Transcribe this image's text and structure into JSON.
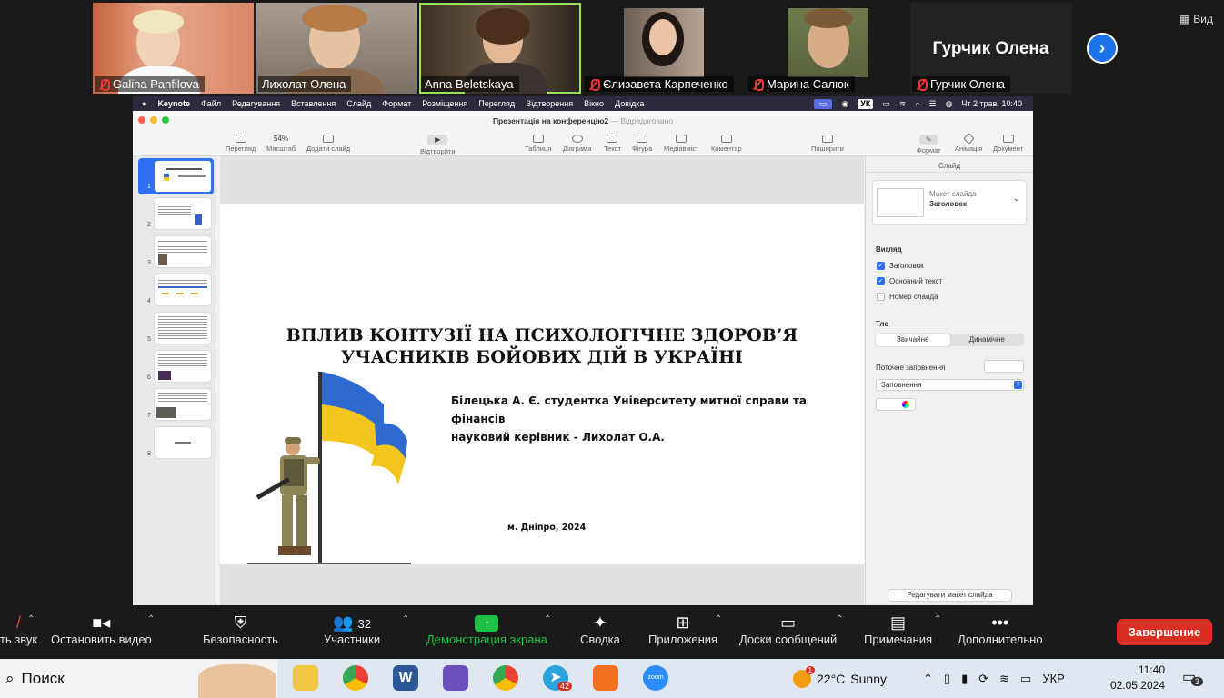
{
  "participants": [
    {
      "name": "Galina Panfilova",
      "muted": true,
      "video": true
    },
    {
      "name": "Лихолат Олена",
      "muted": false,
      "video": true
    },
    {
      "name": "Anna Beletskaya",
      "muted": false,
      "video": true,
      "active": true
    },
    {
      "name": "Єлизавета Карпеченко",
      "muted": true,
      "video": true
    },
    {
      "name": "Марина Салюк",
      "muted": true,
      "video": true
    },
    {
      "name": "Гурчик Олена",
      "muted": true,
      "video": false,
      "big_name": "Гурчик Олена"
    }
  ],
  "view_button": "Вид",
  "mac_menu": {
    "app": "Keynote",
    "items": [
      "Файл",
      "Редагування",
      "Вставлення",
      "Слайд",
      "Формат",
      "Розміщення",
      "Перегляд",
      "Відтворення",
      "Вікно",
      "Довідка"
    ],
    "input_lang": "УК",
    "clock": "Чт 2 трав. 10:40"
  },
  "keynote": {
    "doc_title": "Презентація на конференцію2",
    "doc_status": "— Відредаговано",
    "toolbar": {
      "view": "Перегляд",
      "zoom_value": "54%",
      "zoom": "Масштаб",
      "add_slide": "Додати слайд",
      "play": "Відтворити",
      "table": "Таблиця",
      "chart": "Діаграма",
      "text": "Текст",
      "shape": "Фігура",
      "media": "Медіавміст",
      "comment": "Коментар",
      "share": "Поширити",
      "format": "Формат",
      "animate": "Анімація",
      "document": "Документ"
    },
    "slide_numbers": [
      "1",
      "2",
      "3",
      "4",
      "5",
      "6",
      "7",
      "8"
    ],
    "slide": {
      "title_line1": "ВПЛИВ КОНТУЗІЇ НА ПСИХОЛОГІЧНЕ ЗДОРОВ’Я",
      "title_line2": "УЧАСНИКІВ БОЙОВИХ ДІЙ В УКРАЇНІ",
      "author_line1": "Білецька А. Є. студентка Університету митної справи та фінансів",
      "author_line2": "науковий керівник - Лихолат О.А.",
      "city": "м. Дніпро, 2024"
    },
    "inspector": {
      "tab": "Слайд",
      "layout_label": "Макет слайда",
      "layout_value": "Заголовок",
      "appearance": "Вигляд",
      "check_title": "Заголовок",
      "check_body": "Основний текст",
      "check_number": "Номер слайда",
      "background": "Тло",
      "seg_normal": "Звичайне",
      "seg_dynamic": "Динамічне",
      "current_fill": "Поточне заповнення",
      "fill_select": "Заповнення",
      "edit_layout": "Редагувати макет слайда"
    }
  },
  "zoom_controls": {
    "audio": "ть звук",
    "video": "Остановить видео",
    "security": "Безопасность",
    "participants": "Участники",
    "participants_count": "32",
    "share": "Демонстрация экрана",
    "summary": "Сводка",
    "apps": "Приложения",
    "whiteboards": "Доски сообщений",
    "notes": "Примечания",
    "more": "Дополнительно",
    "end": "Завершение"
  },
  "taskbar": {
    "search": "Поиск",
    "weather_temp": "22°C",
    "weather_desc": "Sunny",
    "weather_badge": "1",
    "telegram_badge": "42",
    "lang": "УКР",
    "time": "11:40",
    "date": "02.05.2024",
    "notif_count": "3"
  },
  "colors": {
    "share_green": "#1cc146",
    "end_red": "#d93025",
    "accent_blue": "#2f6ff2",
    "flag_blue": "#2f6ad0",
    "flag_yellow": "#f4c51a"
  }
}
